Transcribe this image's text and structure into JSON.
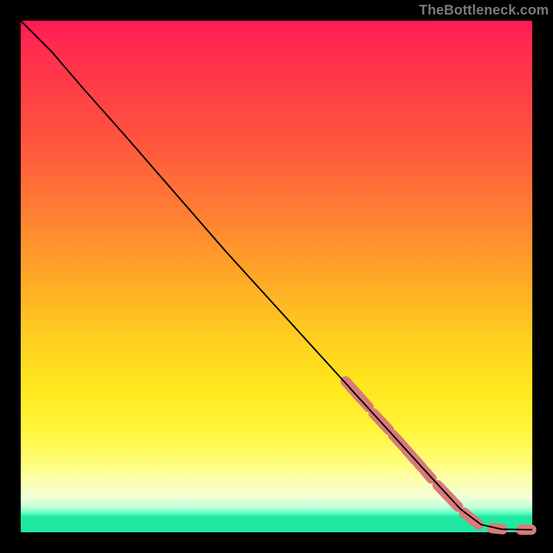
{
  "watermark": "TheBottleneck.com",
  "chart_data": {
    "type": "line",
    "title": "",
    "xlabel": "",
    "ylabel": "",
    "xlim": [
      0,
      100
    ],
    "ylim": [
      0,
      100
    ],
    "curve": [
      {
        "x": 0,
        "y": 100
      },
      {
        "x": 6,
        "y": 94
      },
      {
        "x": 12,
        "y": 87
      },
      {
        "x": 20,
        "y": 78
      },
      {
        "x": 30,
        "y": 66.5
      },
      {
        "x": 40,
        "y": 55
      },
      {
        "x": 50,
        "y": 44
      },
      {
        "x": 60,
        "y": 33
      },
      {
        "x": 70,
        "y": 22
      },
      {
        "x": 80,
        "y": 11
      },
      {
        "x": 86,
        "y": 4.5
      },
      {
        "x": 90,
        "y": 1.5
      },
      {
        "x": 94,
        "y": 0.6
      },
      {
        "x": 100,
        "y": 0.5
      }
    ],
    "highlight_segments": [
      {
        "x1": 63.5,
        "y1": 29.5,
        "x2": 68,
        "y2": 24.5
      },
      {
        "x1": 69,
        "y1": 23.2,
        "x2": 72,
        "y2": 20
      },
      {
        "x1": 72.8,
        "y1": 19,
        "x2": 74.8,
        "y2": 16.8
      },
      {
        "x1": 75.3,
        "y1": 16.2,
        "x2": 78.5,
        "y2": 12.6
      },
      {
        "x1": 79,
        "y1": 12,
        "x2": 80.3,
        "y2": 10.5
      },
      {
        "x1": 81.5,
        "y1": 9.2,
        "x2": 85.5,
        "y2": 5
      },
      {
        "x1": 86.7,
        "y1": 3.8,
        "x2": 89.5,
        "y2": 1.5
      },
      {
        "x1": 92.2,
        "y1": 0.8,
        "x2": 94.2,
        "y2": 0.6
      },
      {
        "x1": 97.8,
        "y1": 0.5,
        "x2": 99.8,
        "y2": 0.5
      }
    ],
    "colors": {
      "curve": "#000000",
      "highlight": "#d97a7a"
    }
  }
}
